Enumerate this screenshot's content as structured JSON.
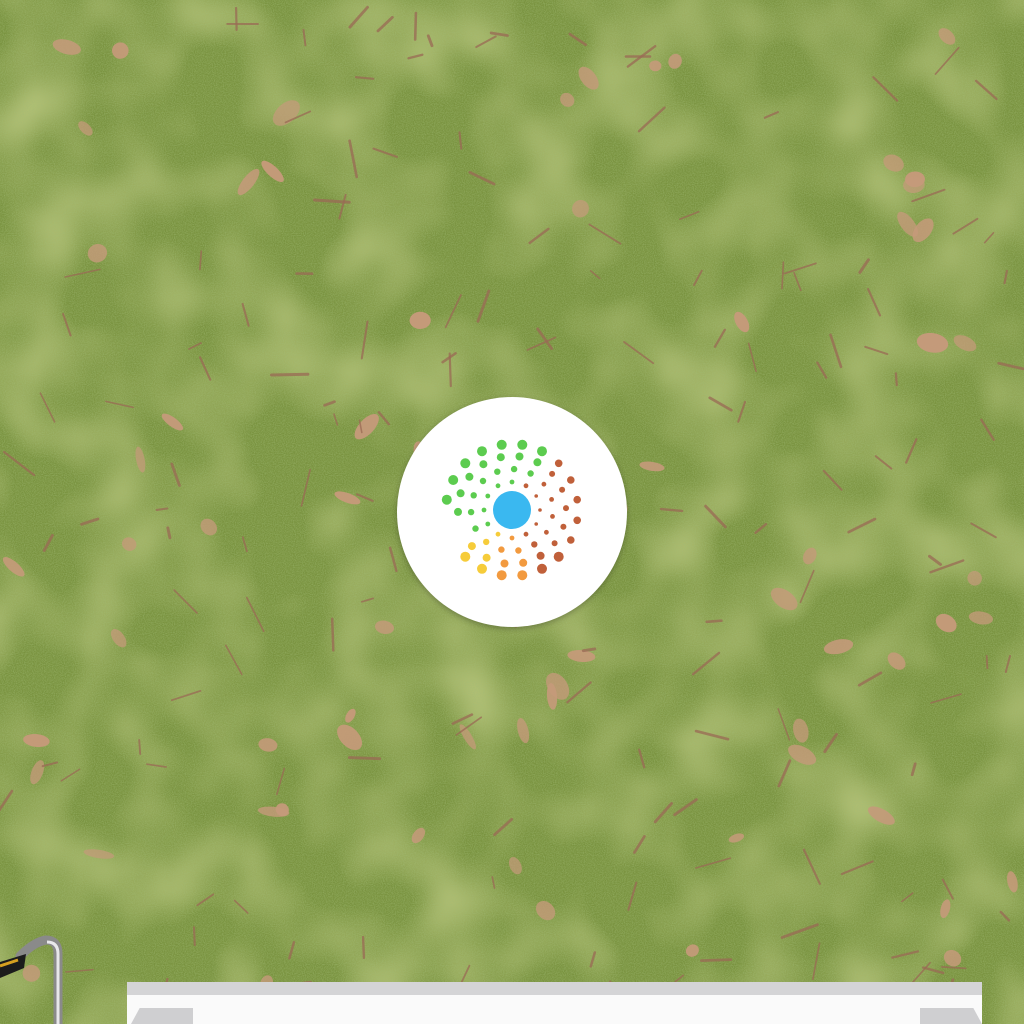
{
  "scene": {
    "ground_color": "#6f8a3a",
    "ground_highlight": "#9aab4a",
    "leaf_color": "#c59a7a",
    "twig_color": "#9a6a55"
  },
  "target": {
    "icon": "dotted-sunburst-icon",
    "center_color": "#3ab8f0",
    "ring_colors": {
      "green": "#5ccc4f",
      "brown": "#c0603a",
      "orange": "#f29a3f",
      "yellow": "#f6cc3a"
    }
  },
  "platform": {
    "top_color": "#d4d4d6",
    "face_color": "#fafafa"
  },
  "tool": {
    "icon": "metal-handle-icon"
  }
}
